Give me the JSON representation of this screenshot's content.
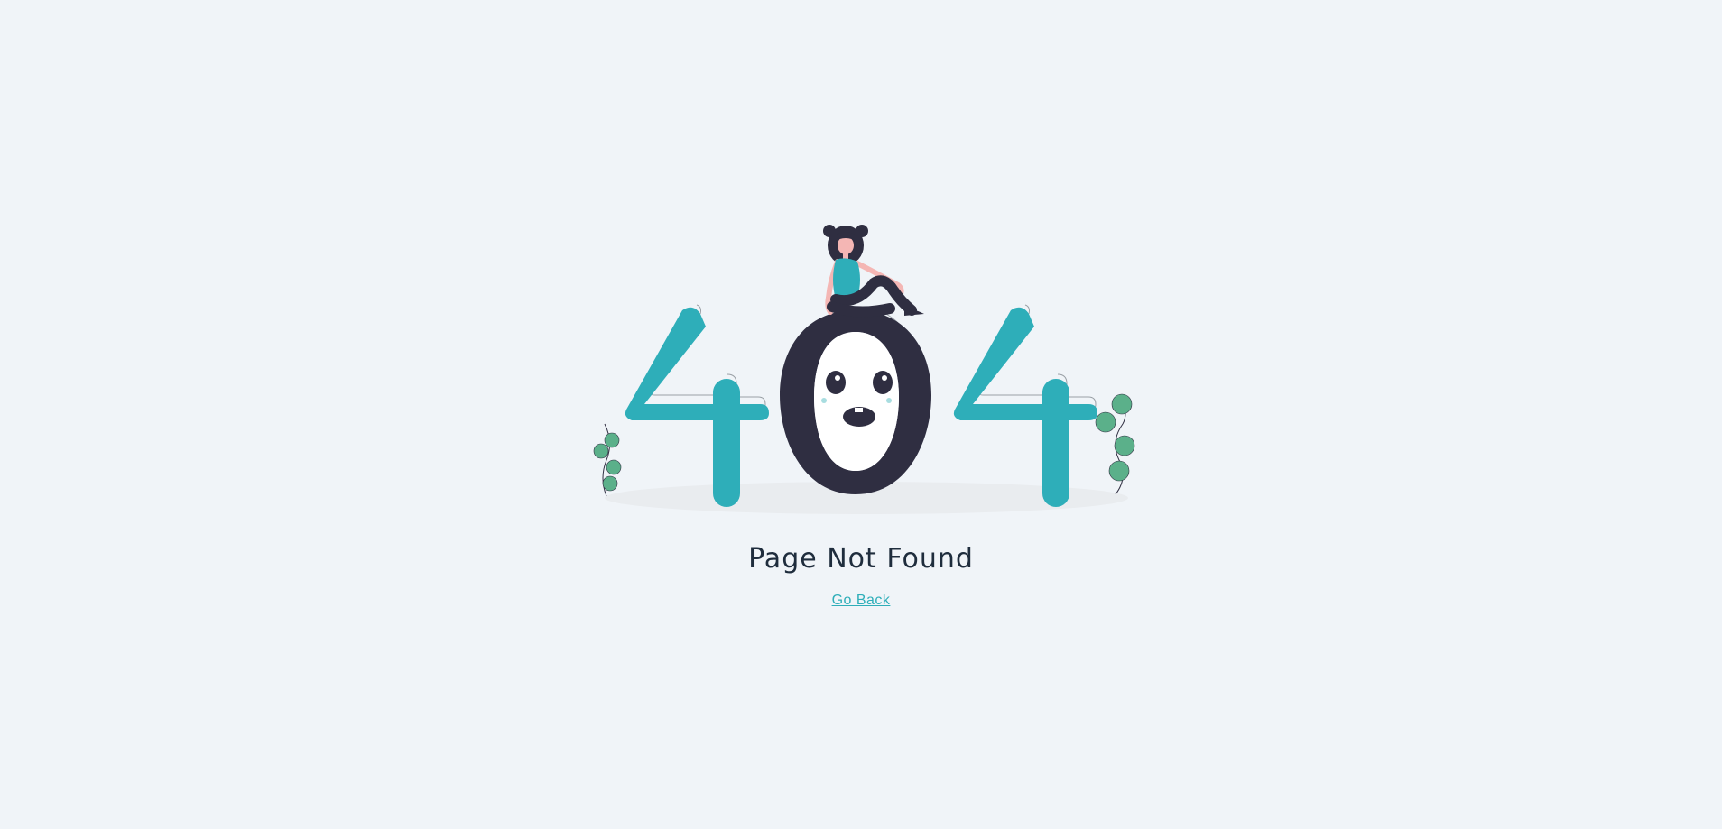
{
  "colors": {
    "background": "#f0f4f8",
    "accent": "#2eaeb9",
    "dark": "#2f2e41",
    "leaf": "#5bb08a",
    "skin": "#f4b6b4",
    "title": "#1f2d3d"
  },
  "illustration": {
    "icon": "404-illustration",
    "digits": [
      "4",
      "0",
      "4"
    ]
  },
  "page": {
    "title": "Page Not Found",
    "back_link": "Go Back"
  }
}
